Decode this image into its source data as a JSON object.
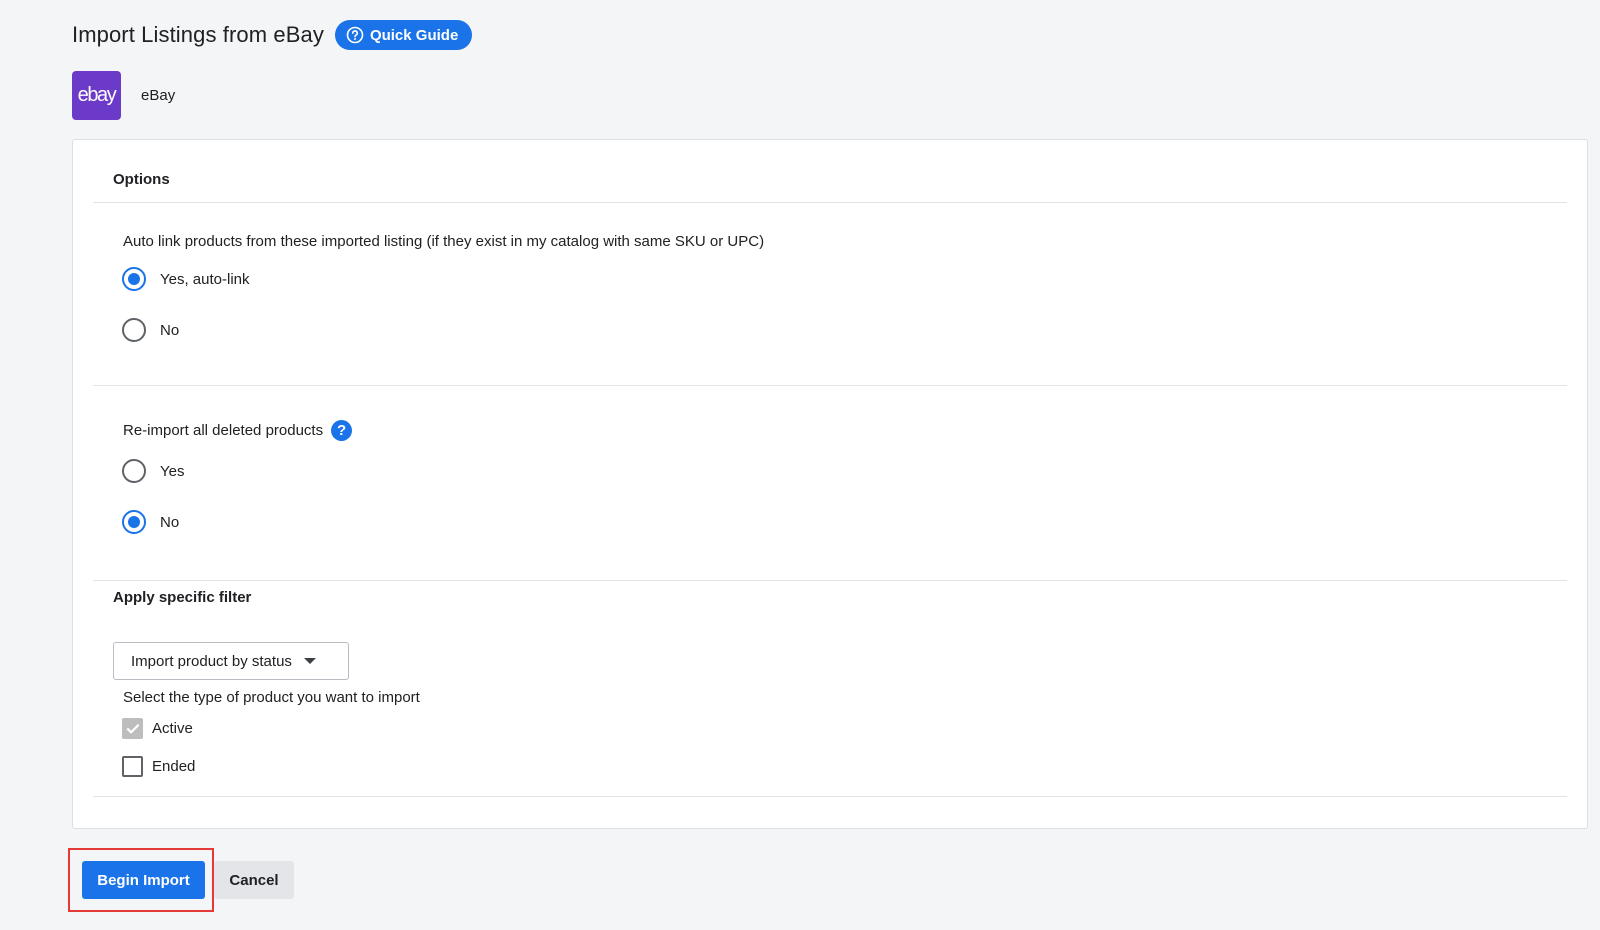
{
  "header": {
    "title": "Import Listings from eBay",
    "guide_label": "Quick Guide"
  },
  "channel": {
    "logo_text": "ebay",
    "name": "eBay"
  },
  "options": {
    "title": "Options",
    "autolink": {
      "question": "Auto link products from these imported listing (if they exist in my catalog with same SKU or UPC)",
      "options": [
        {
          "label": "Yes, auto-link",
          "checked": true
        },
        {
          "label": "No",
          "checked": false
        }
      ]
    },
    "reimport": {
      "question": "Re-import all deleted products",
      "help": "?",
      "options": [
        {
          "label": "Yes",
          "checked": false
        },
        {
          "label": "No",
          "checked": true
        }
      ]
    },
    "filter": {
      "title": "Apply specific filter",
      "select_value": "Import product by status",
      "type_question": "Select the type of product you want to import",
      "types": [
        {
          "label": "Active",
          "checked": true,
          "disabled": true
        },
        {
          "label": "Ended",
          "checked": false,
          "disabled": false
        }
      ]
    }
  },
  "actions": {
    "begin_label": "Begin Import",
    "cancel_label": "Cancel"
  },
  "colors": {
    "primary": "#1a73e8",
    "ebay_brand": "#6c3ac9",
    "highlight": "#e53935"
  }
}
